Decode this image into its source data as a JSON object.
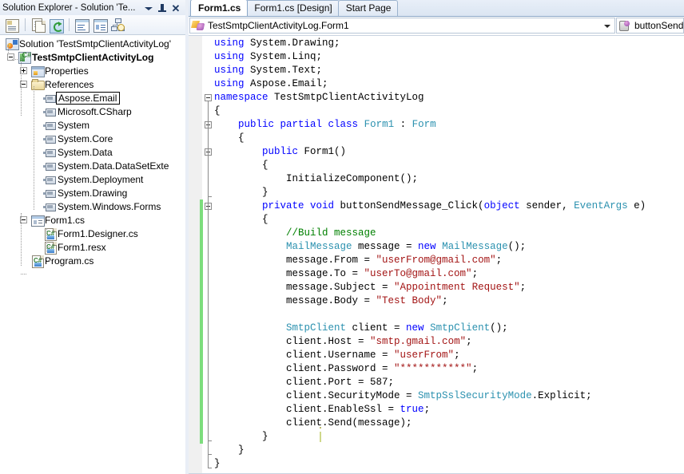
{
  "solution_explorer": {
    "title": "Solution Explorer - Solution 'Te...",
    "title_buttons": [
      {
        "name": "window-menu-dropdown",
        "icon": "caret-down-icon"
      },
      {
        "name": "auto-hide-pin",
        "icon": "pin-icon"
      },
      {
        "name": "close-panel",
        "icon": "close-icon"
      }
    ],
    "toolbar": [
      {
        "name": "properties-button",
        "icon": "properties-page-icon",
        "tooltip": "Properties"
      },
      {
        "name": "show-all-files-button",
        "icon": "show-all-files-icon",
        "tooltip": "Show All Files"
      },
      {
        "name": "refresh-button",
        "icon": "refresh-icon",
        "tooltip": "Refresh"
      },
      {
        "name": "view-code-button",
        "icon": "view-code-icon",
        "tooltip": "View Code"
      },
      {
        "name": "view-designer-button",
        "icon": "view-designer-icon",
        "tooltip": "View Designer"
      },
      {
        "name": "object-browser-button",
        "icon": "object-browser-icon",
        "tooltip": "Object Browser"
      }
    ],
    "tree": [
      {
        "label": "Solution 'TestSmtpClientActivityLog'",
        "icon": "solution-icon",
        "depth": 0,
        "expander": "none",
        "bold": false,
        "selected": false
      },
      {
        "label": "TestSmtpClientActivityLog",
        "icon": "project-csharp-icon",
        "depth": 1,
        "expander": "minus",
        "bold": true,
        "selected": false
      },
      {
        "label": "Properties",
        "icon": "properties-folder-icon",
        "depth": 2,
        "expander": "plus",
        "bold": false,
        "selected": false
      },
      {
        "label": "References",
        "icon": "references-folder-icon",
        "depth": 2,
        "expander": "minus",
        "bold": false,
        "selected": false
      },
      {
        "label": "Aspose.Email",
        "icon": "reference-icon",
        "depth": 3,
        "expander": "none",
        "bold": false,
        "selected": true
      },
      {
        "label": "Microsoft.CSharp",
        "icon": "reference-icon",
        "depth": 3,
        "expander": "none",
        "bold": false,
        "selected": false
      },
      {
        "label": "System",
        "icon": "reference-icon",
        "depth": 3,
        "expander": "none",
        "bold": false,
        "selected": false
      },
      {
        "label": "System.Core",
        "icon": "reference-icon",
        "depth": 3,
        "expander": "none",
        "bold": false,
        "selected": false
      },
      {
        "label": "System.Data",
        "icon": "reference-icon",
        "depth": 3,
        "expander": "none",
        "bold": false,
        "selected": false
      },
      {
        "label": "System.Data.DataSetExte",
        "icon": "reference-icon",
        "depth": 3,
        "expander": "none",
        "bold": false,
        "selected": false
      },
      {
        "label": "System.Deployment",
        "icon": "reference-icon",
        "depth": 3,
        "expander": "none",
        "bold": false,
        "selected": false
      },
      {
        "label": "System.Drawing",
        "icon": "reference-icon",
        "depth": 3,
        "expander": "none",
        "bold": false,
        "selected": false
      },
      {
        "label": "System.Windows.Forms",
        "icon": "reference-icon",
        "depth": 3,
        "expander": "none",
        "bold": false,
        "selected": false
      },
      {
        "label": "Form1.cs",
        "icon": "form-icon",
        "depth": 2,
        "expander": "minus",
        "bold": false,
        "selected": false
      },
      {
        "label": "Form1.Designer.cs",
        "icon": "csharp-file-icon",
        "depth": 3,
        "expander": "none",
        "bold": false,
        "selected": false
      },
      {
        "label": "Form1.resx",
        "icon": "csharp-file-icon",
        "depth": 3,
        "expander": "none",
        "bold": false,
        "selected": false
      },
      {
        "label": "Program.cs",
        "icon": "csharp-file-icon",
        "depth": 2,
        "expander": "none",
        "bold": false,
        "selected": false
      }
    ]
  },
  "editor": {
    "tabs": [
      {
        "label": "Form1.cs",
        "active": true
      },
      {
        "label": "Form1.cs [Design]",
        "active": false
      },
      {
        "label": "Start Page",
        "active": false
      }
    ],
    "navigation": {
      "type_combo": {
        "value": "TestSmtpClientActivityLog.Form1",
        "icon": "namespace-class-icon"
      },
      "member_combo": {
        "value": "buttonSendMe",
        "icon": "event-method-icon"
      }
    },
    "colors": {
      "keyword": "#0000ff",
      "type": "#2b91af",
      "string": "#a31515",
      "comment": "#008000",
      "plain": "#000000",
      "change_bar": "#7ddd7d"
    },
    "code_lines": [
      {
        "tokens": [
          {
            "c": "k",
            "s": "using"
          },
          {
            "c": "p",
            "s": " System.Drawing;"
          }
        ],
        "outline": "none",
        "changed": false
      },
      {
        "tokens": [
          {
            "c": "k",
            "s": "using"
          },
          {
            "c": "p",
            "s": " System.Linq;"
          }
        ],
        "outline": "none",
        "changed": false
      },
      {
        "tokens": [
          {
            "c": "k",
            "s": "using"
          },
          {
            "c": "p",
            "s": " System.Text;"
          }
        ],
        "outline": "none",
        "changed": false
      },
      {
        "tokens": [
          {
            "c": "k",
            "s": "using"
          },
          {
            "c": "p",
            "s": " Aspose.Email;"
          }
        ],
        "outline": "none",
        "changed": false
      },
      {
        "tokens": [
          {
            "c": "k",
            "s": "namespace"
          },
          {
            "c": "p",
            "s": " TestSmtpClientActivityLog"
          }
        ],
        "outline": "box",
        "changed": false
      },
      {
        "tokens": [
          {
            "c": "p",
            "s": "{"
          }
        ],
        "outline": "line",
        "changed": false
      },
      {
        "tokens": [
          {
            "c": "p",
            "s": "    "
          },
          {
            "c": "k",
            "s": "public partial class"
          },
          {
            "c": "p",
            "s": " "
          },
          {
            "c": "t",
            "s": "Form1"
          },
          {
            "c": "p",
            "s": " : "
          },
          {
            "c": "t",
            "s": "Form"
          }
        ],
        "outline": "box",
        "changed": false
      },
      {
        "tokens": [
          {
            "c": "p",
            "s": "    {"
          }
        ],
        "outline": "line",
        "changed": false
      },
      {
        "tokens": [
          {
            "c": "p",
            "s": "        "
          },
          {
            "c": "k",
            "s": "public"
          },
          {
            "c": "p",
            "s": " Form1()"
          }
        ],
        "outline": "box",
        "changed": false
      },
      {
        "tokens": [
          {
            "c": "p",
            "s": "        {"
          }
        ],
        "outline": "line",
        "changed": false
      },
      {
        "tokens": [
          {
            "c": "p",
            "s": "            InitializeComponent();"
          }
        ],
        "outline": "line",
        "changed": false
      },
      {
        "tokens": [
          {
            "c": "p",
            "s": "        }"
          }
        ],
        "outline": "end",
        "changed": false
      },
      {
        "tokens": [
          {
            "c": "p",
            "s": "        "
          },
          {
            "c": "k",
            "s": "private void"
          },
          {
            "c": "p",
            "s": " buttonSendMessage_Click("
          },
          {
            "c": "k",
            "s": "object"
          },
          {
            "c": "p",
            "s": " sender, "
          },
          {
            "c": "t",
            "s": "EventArgs"
          },
          {
            "c": "p",
            "s": " e)"
          }
        ],
        "outline": "box",
        "changed": true
      },
      {
        "tokens": [
          {
            "c": "p",
            "s": "        {"
          }
        ],
        "outline": "line",
        "changed": true
      },
      {
        "tokens": [
          {
            "c": "p",
            "s": "            "
          },
          {
            "c": "c",
            "s": "//Build message"
          }
        ],
        "outline": "line",
        "changed": true
      },
      {
        "tokens": [
          {
            "c": "p",
            "s": "            "
          },
          {
            "c": "t",
            "s": "MailMessage"
          },
          {
            "c": "p",
            "s": " message = "
          },
          {
            "c": "k",
            "s": "new"
          },
          {
            "c": "p",
            "s": " "
          },
          {
            "c": "t",
            "s": "MailMessage"
          },
          {
            "c": "p",
            "s": "();"
          }
        ],
        "outline": "line",
        "changed": true
      },
      {
        "tokens": [
          {
            "c": "p",
            "s": "            message.From = "
          },
          {
            "c": "s",
            "s": "\"userFrom@gmail.com\""
          },
          {
            "c": "p",
            "s": ";"
          }
        ],
        "outline": "line",
        "changed": true
      },
      {
        "tokens": [
          {
            "c": "p",
            "s": "            message.To = "
          },
          {
            "c": "s",
            "s": "\"userTo@gmail.com\""
          },
          {
            "c": "p",
            "s": ";"
          }
        ],
        "outline": "line",
        "changed": true
      },
      {
        "tokens": [
          {
            "c": "p",
            "s": "            message.Subject = "
          },
          {
            "c": "s",
            "s": "\"Appointment Request\""
          },
          {
            "c": "p",
            "s": ";"
          }
        ],
        "outline": "line",
        "changed": true
      },
      {
        "tokens": [
          {
            "c": "p",
            "s": "            message.Body = "
          },
          {
            "c": "s",
            "s": "\"Test Body\""
          },
          {
            "c": "p",
            "s": ";"
          }
        ],
        "outline": "line",
        "changed": true
      },
      {
        "tokens": [
          {
            "c": "p",
            "s": ""
          }
        ],
        "outline": "line",
        "changed": true
      },
      {
        "tokens": [
          {
            "c": "p",
            "s": "            "
          },
          {
            "c": "t",
            "s": "SmtpClient"
          },
          {
            "c": "p",
            "s": " client = "
          },
          {
            "c": "k",
            "s": "new"
          },
          {
            "c": "p",
            "s": " "
          },
          {
            "c": "t",
            "s": "SmtpClient"
          },
          {
            "c": "p",
            "s": "();"
          }
        ],
        "outline": "line",
        "changed": true
      },
      {
        "tokens": [
          {
            "c": "p",
            "s": "            client.Host = "
          },
          {
            "c": "s",
            "s": "\"smtp.gmail.com\""
          },
          {
            "c": "p",
            "s": ";"
          }
        ],
        "outline": "line",
        "changed": true
      },
      {
        "tokens": [
          {
            "c": "p",
            "s": "            client.Username = "
          },
          {
            "c": "s",
            "s": "\"userFrom\""
          },
          {
            "c": "p",
            "s": ";"
          }
        ],
        "outline": "line",
        "changed": true
      },
      {
        "tokens": [
          {
            "c": "p",
            "s": "            client.Password = "
          },
          {
            "c": "s",
            "s": "\"***********\""
          },
          {
            "c": "p",
            "s": ";"
          }
        ],
        "outline": "line",
        "changed": true
      },
      {
        "tokens": [
          {
            "c": "p",
            "s": "            client.Port = 587;"
          }
        ],
        "outline": "line",
        "changed": true
      },
      {
        "tokens": [
          {
            "c": "p",
            "s": "            client.SecurityMode = "
          },
          {
            "c": "t",
            "s": "SmtpSslSecurityMode"
          },
          {
            "c": "p",
            "s": ".Explicit;"
          }
        ],
        "outline": "line",
        "changed": true
      },
      {
        "tokens": [
          {
            "c": "p",
            "s": "            client.EnableSsl = "
          },
          {
            "c": "k",
            "s": "true"
          },
          {
            "c": "p",
            "s": ";"
          }
        ],
        "outline": "line",
        "changed": true
      },
      {
        "tokens": [
          {
            "c": "p",
            "s": "            client.Send(message);"
          }
        ],
        "outline": "line",
        "changed": true
      },
      {
        "tokens": [
          {
            "c": "p",
            "s": "        }"
          }
        ],
        "outline": "end",
        "changed": true
      },
      {
        "tokens": [
          {
            "c": "p",
            "s": "    }"
          }
        ],
        "outline": "end",
        "changed": false
      },
      {
        "tokens": [
          {
            "c": "p",
            "s": "}"
          }
        ],
        "outline": "end",
        "changed": false
      }
    ]
  }
}
